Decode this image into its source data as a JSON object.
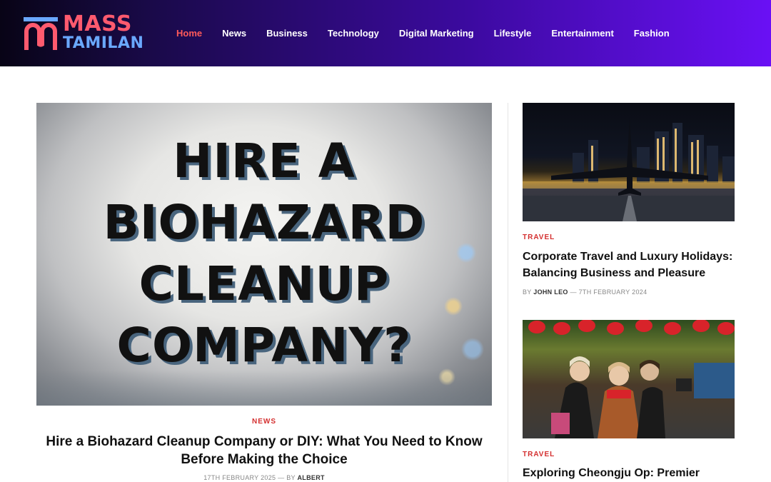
{
  "brand": {
    "logo_line1": "MASS",
    "logo_line2": "TAMILAN",
    "logo_primary": "#ff5a6e",
    "logo_secondary": "#6aa8ff"
  },
  "nav": {
    "items": [
      "Home",
      "News",
      "Business",
      "Technology",
      "Digital Marketing",
      "Lifestyle",
      "Entertainment",
      "Fashion"
    ],
    "active": "Home",
    "active_color": "#ff5a5a"
  },
  "featured": {
    "image_text": [
      "HIRE A",
      "BIOHAZARD",
      "CLEANUP",
      "COMPANY?"
    ],
    "category": "NEWS",
    "title": "Hire a Biohazard Cleanup Company or DIY: What You Need to Know Before Making the Choice",
    "date": "17TH FEBRUARY 2025",
    "by": "BY",
    "author": "ALBERT"
  },
  "side_posts": [
    {
      "category": "TRAVEL",
      "title": "Corporate Travel and Luxury Holidays: Balancing Business and Pleasure",
      "by": "BY",
      "author": "JOHN LEO",
      "date": "7TH FEBRUARY 2024"
    },
    {
      "category": "TRAVEL",
      "title": "Exploring Cheongju Op: Premier"
    }
  ],
  "category_color": "#d42f2f"
}
